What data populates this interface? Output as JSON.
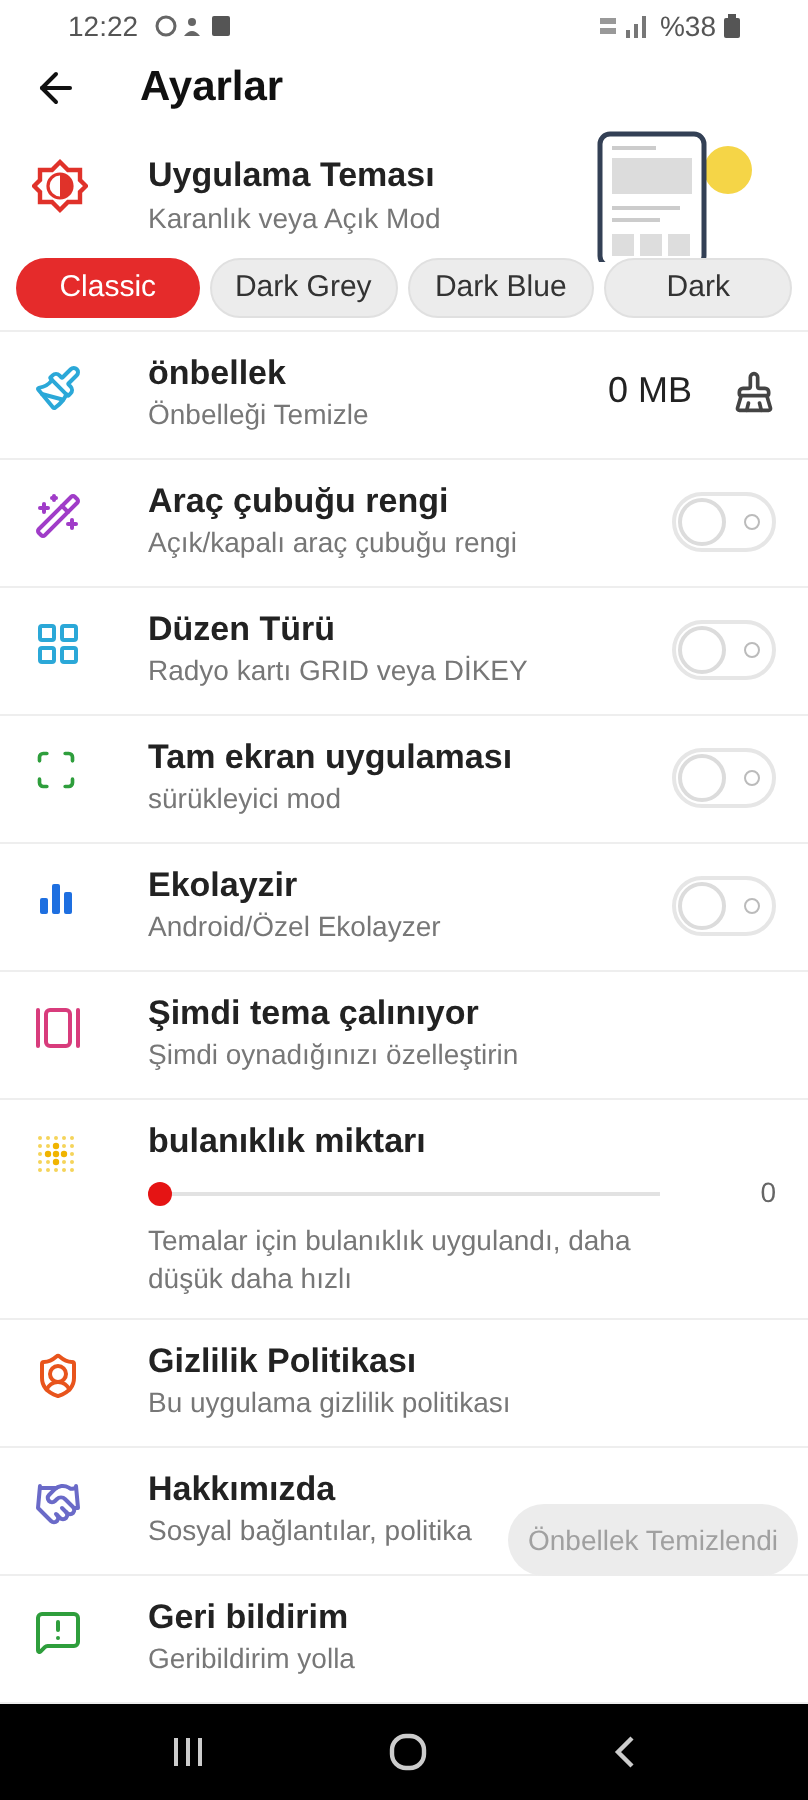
{
  "status_bar": {
    "time": "12:22",
    "battery": "%38"
  },
  "header": {
    "title": "Ayarlar"
  },
  "theme": {
    "title": "Uygulama Teması",
    "subtitle": "Karanlık veya Açık Mod",
    "chips": [
      {
        "label": "Classic",
        "selected": true
      },
      {
        "label": "Dark Grey",
        "selected": false
      },
      {
        "label": "Dark Blue",
        "selected": false
      },
      {
        "label": "Dark",
        "selected": false
      }
    ]
  },
  "settings": [
    {
      "kind": "value",
      "title": "önbellek",
      "subtitle": "Önbelleği Temizle",
      "value": "0 MB"
    },
    {
      "kind": "toggle",
      "title": "Araç çubuğu rengi",
      "subtitle": "Açık/kapalı araç çubuğu rengi",
      "on": false
    },
    {
      "kind": "toggle",
      "title": "Düzen Türü",
      "subtitle": "Radyo kartı GRID veya DİKEY",
      "on": false
    },
    {
      "kind": "toggle",
      "title": "Tam ekran uygulaması",
      "subtitle": "sürükleyici mod",
      "on": false
    },
    {
      "kind": "toggle",
      "title": "Ekolayzir",
      "subtitle": "Android/Özel Ekolayzer",
      "on": false
    },
    {
      "kind": "plain",
      "title": "Şimdi tema çalınıyor",
      "subtitle": "Şimdi oynadığınızı özelleştirin"
    },
    {
      "kind": "slider",
      "title": "bulanıklık miktarı",
      "level": 0,
      "reading": "0",
      "subtitle": "Temalar için bulanıklık uygulandı, daha düşük daha hızlı"
    },
    {
      "kind": "plain",
      "title": "Gizlilik Politikası",
      "subtitle": "Bu uygulama gizlilik politikası"
    },
    {
      "kind": "plain",
      "title": "Hakkımızda",
      "subtitle": "Sosyal bağlantılar, politika"
    },
    {
      "kind": "plain",
      "title": "Geri bildirim",
      "subtitle": "Geribildirim yolla"
    }
  ],
  "toast": "Önbellek Temizlendi"
}
